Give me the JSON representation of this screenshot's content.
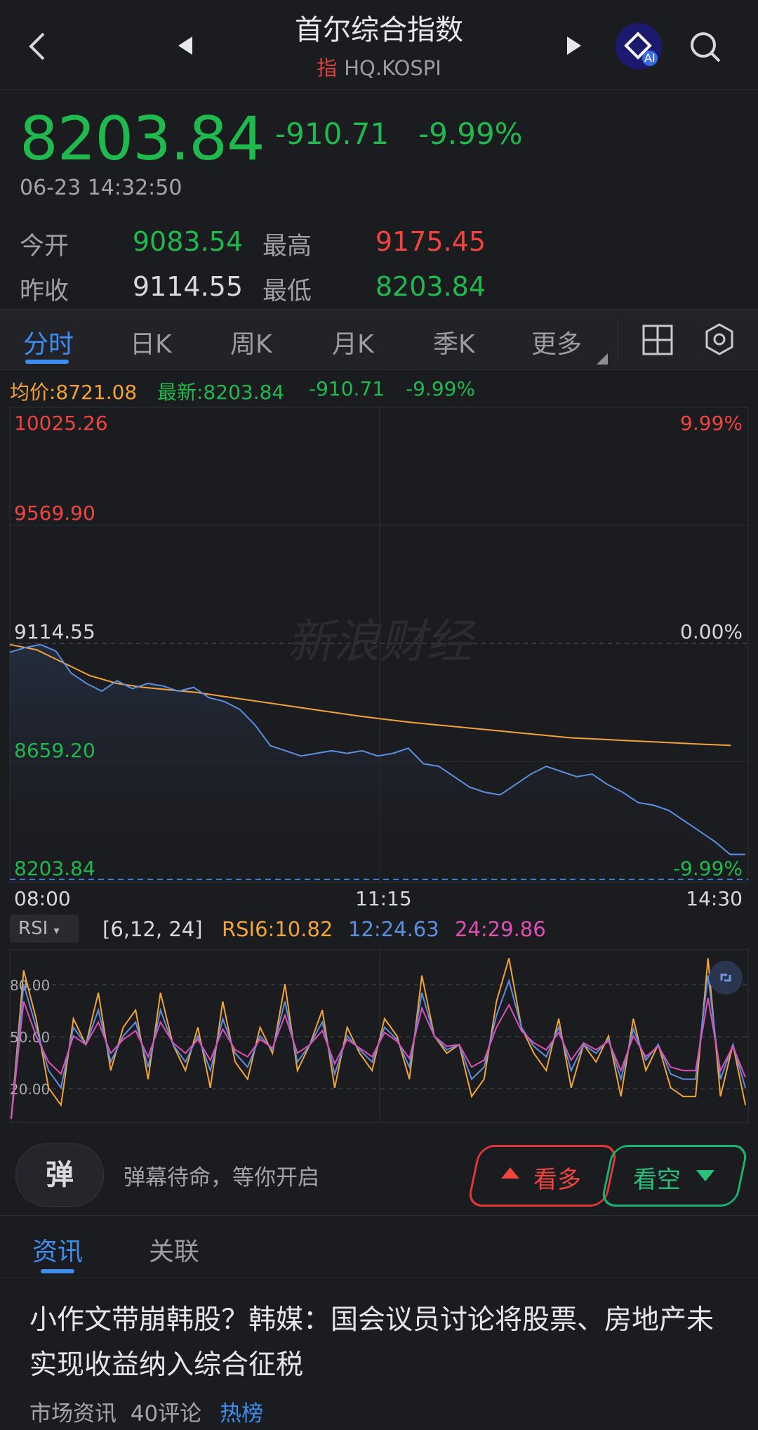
{
  "header": {
    "title": "首尔综合指数",
    "subtitle_tag": "指",
    "subtitle_code": "HQ.KOSPI",
    "ai_badge": "AI"
  },
  "quote": {
    "price": "8203.84",
    "change": "-910.71",
    "change_pct": "-9.99%",
    "datetime": "06-23  14:32:50",
    "open_label": "今开",
    "open": "9083.54",
    "high_label": "最高",
    "high": "9175.45",
    "prev_close_label": "昨收",
    "prev_close": "9114.55",
    "low_label": "最低",
    "low": "8203.84"
  },
  "tabs": [
    "分时",
    "日K",
    "周K",
    "月K",
    "季K",
    "更多"
  ],
  "chart_info": {
    "avg": "均价:8721.08",
    "latest": "最新:8203.84",
    "change": "-910.71",
    "change_pct": "-9.99%"
  },
  "chart_axis": {
    "y_left": [
      "10025.26",
      "9569.90",
      "9114.55",
      "8659.20",
      "8203.84"
    ],
    "y_right": [
      "9.99%",
      "0.00%",
      "-9.99%"
    ],
    "x": [
      "08:00",
      "11:15",
      "14:30"
    ],
    "watermark": "新浪财经"
  },
  "rsi": {
    "selector": "RSI",
    "params": "[6,12, 24]",
    "rsi6": "RSI6:10.82",
    "rsi12": "12:24.63",
    "rsi24": "24:29.86",
    "levels": [
      "80.00",
      "50.00",
      "20.00"
    ]
  },
  "chart_data": {
    "type": "line",
    "title": "",
    "x_range": [
      "08:00",
      "14:30"
    ],
    "ylim": [
      8203.84,
      10025.26
    ],
    "reference_line": 9114.55,
    "series": [
      {
        "name": "最新",
        "color": "#5b8fe0",
        "values": [
          9080,
          9098,
          9110,
          9085,
          9000,
          8960,
          8930,
          8970,
          8940,
          8960,
          8950,
          8930,
          8945,
          8905,
          8890,
          8860,
          8800,
          8720,
          8700,
          8680,
          8690,
          8700,
          8690,
          8700,
          8680,
          8690,
          8710,
          8650,
          8640,
          8600,
          8560,
          8540,
          8530,
          8570,
          8610,
          8640,
          8620,
          8600,
          8610,
          8570,
          8540,
          8500,
          8490,
          8470,
          8430,
          8390,
          8350,
          8300,
          8300
        ]
      },
      {
        "name": "均价",
        "color": "#f2a33a",
        "values": [
          9110,
          9090,
          9040,
          8990,
          8960,
          8945,
          8935,
          8925,
          8910,
          8895,
          8880,
          8865,
          8850,
          8835,
          8822,
          8810,
          8800,
          8790,
          8780,
          8770,
          8760,
          8750,
          8745,
          8740,
          8735,
          8730,
          8725,
          8721
        ]
      }
    ]
  },
  "rsi_chart_data": {
    "type": "line",
    "ylim": [
      0,
      100
    ],
    "series": [
      {
        "name": "RSI6",
        "color": "#f2a33a",
        "values": [
          2,
          88,
          60,
          20,
          10,
          60,
          45,
          75,
          30,
          55,
          65,
          25,
          75,
          45,
          30,
          55,
          20,
          70,
          35,
          25,
          55,
          40,
          80,
          30,
          45,
          65,
          20,
          55,
          40,
          30,
          60,
          50,
          25,
          85,
          50,
          40,
          45,
          15,
          25,
          70,
          95,
          55,
          40,
          30,
          60,
          20,
          45,
          35,
          50,
          15,
          60,
          30,
          45,
          20,
          15,
          15,
          95,
          15,
          45,
          10
        ]
      },
      {
        "name": "12",
        "color": "#5b8fe0",
        "values": [
          2,
          80,
          55,
          30,
          20,
          55,
          45,
          65,
          35,
          50,
          58,
          32,
          65,
          45,
          35,
          50,
          30,
          60,
          40,
          32,
          50,
          42,
          70,
          35,
          45,
          58,
          28,
          50,
          42,
          35,
          55,
          48,
          32,
          75,
          50,
          42,
          45,
          25,
          32,
          62,
          82,
          55,
          44,
          38,
          55,
          30,
          45,
          40,
          48,
          25,
          54,
          36,
          45,
          28,
          25,
          25,
          85,
          25,
          45,
          20
        ]
      },
      {
        "name": "24",
        "color": "#e04fb4",
        "values": [
          2,
          70,
          50,
          35,
          28,
          50,
          45,
          58,
          40,
          48,
          53,
          38,
          58,
          46,
          40,
          48,
          36,
          54,
          42,
          38,
          48,
          43,
          62,
          40,
          45,
          53,
          34,
          48,
          43,
          38,
          52,
          47,
          37,
          66,
          50,
          44,
          45,
          32,
          36,
          55,
          68,
          53,
          46,
          42,
          52,
          36,
          46,
          42,
          47,
          30,
          50,
          38,
          44,
          32,
          30,
          30,
          72,
          30,
          44,
          26
        ]
      }
    ]
  },
  "bottom_bar": {
    "bullet_icon_label": "弹",
    "bullet_hint": "弹幕待命，等你开启",
    "bull": "看多",
    "bear": "看空"
  },
  "news_tabs": [
    "资讯",
    "关联"
  ],
  "news": {
    "headline": "小作文带崩韩股？韩媒：国会议员讨论将股票、房地产未实现收益纳入综合征税",
    "source": "市场资讯",
    "comments": "40评论",
    "tag": "热榜"
  }
}
